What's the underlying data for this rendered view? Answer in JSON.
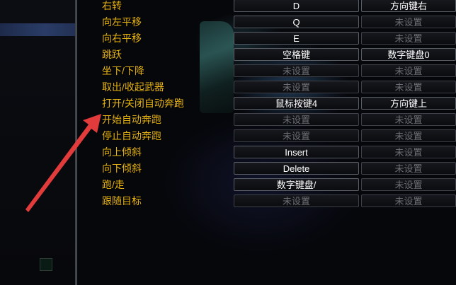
{
  "bindings": [
    {
      "action": "右转",
      "key1": "D",
      "key2": "方向键右"
    },
    {
      "action": "向左平移",
      "key1": "Q",
      "key2": "未设置"
    },
    {
      "action": "向右平移",
      "key1": "E",
      "key2": "未设置"
    },
    {
      "action": "跳跃",
      "key1": "空格键",
      "key2": "数字键盘0"
    },
    {
      "action": "坐下/下降",
      "key1": "未设置",
      "key2": "未设置"
    },
    {
      "action": "取出/收起武器",
      "key1": "未设置",
      "key2": "未设置"
    },
    {
      "action": "打开/关闭自动奔跑",
      "key1": "鼠标按键4",
      "key2": "方向键上"
    },
    {
      "action": "开始自动奔跑",
      "key1": "未设置",
      "key2": "未设置"
    },
    {
      "action": "停止自动奔跑",
      "key1": "未设置",
      "key2": "未设置"
    },
    {
      "action": "向上倾斜",
      "key1": "Insert",
      "key2": "未设置"
    },
    {
      "action": "向下倾斜",
      "key1": "Delete",
      "key2": "未设置"
    },
    {
      "action": "跑/走",
      "key1": "数字键盘/",
      "key2": "未设置"
    },
    {
      "action": "跟随目标",
      "key1": "未设置",
      "key2": "未设置"
    }
  ],
  "unset_text": "未设置",
  "colors": {
    "label": "#e7b414",
    "key_set": "#ffffff",
    "key_unset": "#6b6e74",
    "arrow": "#e23b3b"
  }
}
